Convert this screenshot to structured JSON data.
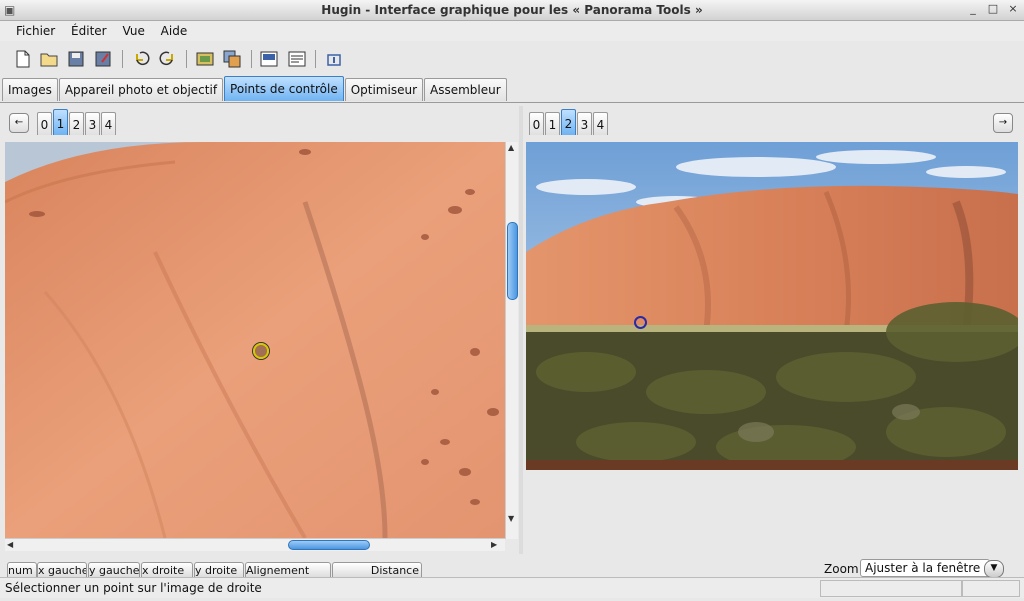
{
  "window": {
    "title": "Hugin - Interface graphique pour les « Panorama Tools »"
  },
  "menu": [
    "Fichier",
    "Éditer",
    "Vue",
    "Aide"
  ],
  "toolbar_icons": [
    "new-file-icon",
    "open-folder-icon",
    "save-icon",
    "save-as-icon",
    "undo-icon",
    "redo-icon",
    "stitch-icon",
    "batch-icon",
    "preview-icon",
    "fast-preview-icon",
    "info-icon"
  ],
  "tabs": [
    {
      "label": "Images",
      "active": false
    },
    {
      "label": "Appareil photo et objectif",
      "active": false
    },
    {
      "label": "Points de contrôle",
      "active": true
    },
    {
      "label": "Optimiseur",
      "active": false
    },
    {
      "label": "Assembleur",
      "active": false
    }
  ],
  "left_panel": {
    "image_tabs": [
      "0",
      "1",
      "2",
      "3",
      "4"
    ],
    "active_index": 1,
    "nav_button": "←"
  },
  "right_panel": {
    "image_tabs": [
      "0",
      "1",
      "2",
      "3",
      "4"
    ],
    "active_index": 2,
    "nav_button": "→"
  },
  "points_table": {
    "columns": [
      "num",
      "x gauche",
      "y gauche",
      "x droite",
      "y droite",
      "Alignement",
      "Distance"
    ]
  },
  "zoom": {
    "label": "Zoom :",
    "value": "Ajuster à la fenêtre"
  },
  "status": {
    "text": "Sélectionner un point sur l'image de droite"
  },
  "colors": {
    "accent": "#6fb3f2",
    "rock": "#e6936a",
    "sky": "#7aa8d8"
  }
}
